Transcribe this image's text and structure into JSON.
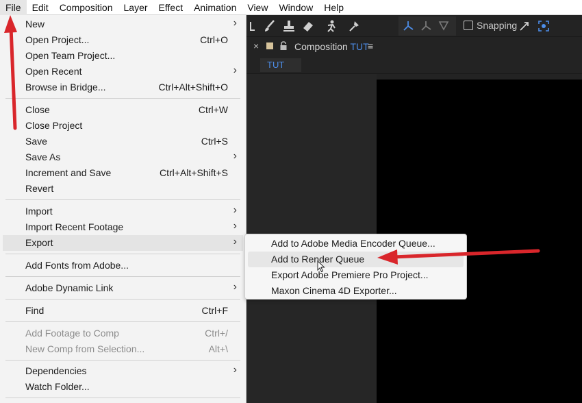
{
  "menubar": {
    "items": [
      "File",
      "Edit",
      "Composition",
      "Layer",
      "Effect",
      "Animation",
      "View",
      "Window",
      "Help"
    ]
  },
  "toolbar": {
    "snapping_label": "Snapping",
    "tool_icons": [
      "camera-icon",
      "brush-icon",
      "clone-stamp-icon",
      "eraser-icon",
      "roto-brush-icon",
      "puppet-pin-icon",
      "axis-world-icon",
      "axis-local-icon",
      "axis-view-icon",
      "snap-icon",
      "snap-target-icon"
    ]
  },
  "panel": {
    "close_glyph": "×",
    "title_prefix": "Composition",
    "comp_name": "TUT",
    "menu_glyph": "≡",
    "tab_label": "TUT"
  },
  "file_menu": {
    "items": [
      {
        "label": "New",
        "shortcut": "",
        "submenu": true
      },
      {
        "label": "Open Project...",
        "shortcut": "Ctrl+O",
        "submenu": false
      },
      {
        "label": "Open Team Project...",
        "shortcut": "",
        "submenu": false
      },
      {
        "label": "Open Recent",
        "shortcut": "",
        "submenu": true
      },
      {
        "label": "Browse in Bridge...",
        "shortcut": "Ctrl+Alt+Shift+O",
        "submenu": false
      },
      {
        "label": "Close",
        "shortcut": "Ctrl+W",
        "submenu": false
      },
      {
        "label": "Close Project",
        "shortcut": "",
        "submenu": false
      },
      {
        "label": "Save",
        "shortcut": "Ctrl+S",
        "submenu": false
      },
      {
        "label": "Save As",
        "shortcut": "",
        "submenu": true
      },
      {
        "label": "Increment and Save",
        "shortcut": "Ctrl+Alt+Shift+S",
        "submenu": false
      },
      {
        "label": "Revert",
        "shortcut": "",
        "submenu": false
      },
      {
        "label": "Import",
        "shortcut": "",
        "submenu": true
      },
      {
        "label": "Import Recent Footage",
        "shortcut": "",
        "submenu": true
      },
      {
        "label": "Export",
        "shortcut": "",
        "submenu": true
      },
      {
        "label": "Add Fonts from Adobe...",
        "shortcut": "",
        "submenu": false
      },
      {
        "label": "Adobe Dynamic Link",
        "shortcut": "",
        "submenu": true
      },
      {
        "label": "Find",
        "shortcut": "Ctrl+F",
        "submenu": false
      },
      {
        "label": "Add Footage to Comp",
        "shortcut": "Ctrl+/",
        "submenu": false,
        "disabled": true
      },
      {
        "label": "New Comp from Selection...",
        "shortcut": "Alt+\\",
        "submenu": false,
        "disabled": true
      },
      {
        "label": "Dependencies",
        "shortcut": "",
        "submenu": true
      },
      {
        "label": "Watch Folder...",
        "shortcut": "",
        "submenu": false
      }
    ],
    "submenu_arrow": "›",
    "highlighted": "Export"
  },
  "export_submenu": {
    "items": [
      "Add to Adobe Media Encoder Queue...",
      "Add to Render Queue",
      "Export Adobe Premiere Pro Project...",
      "Maxon Cinema 4D Exporter..."
    ],
    "highlighted": "Add to Render Queue"
  },
  "colors": {
    "annotation_red": "#d9262b",
    "accent_blue": "#4d8eea",
    "app_dark": "#232323",
    "menu_bg": "#f3f3f3"
  }
}
